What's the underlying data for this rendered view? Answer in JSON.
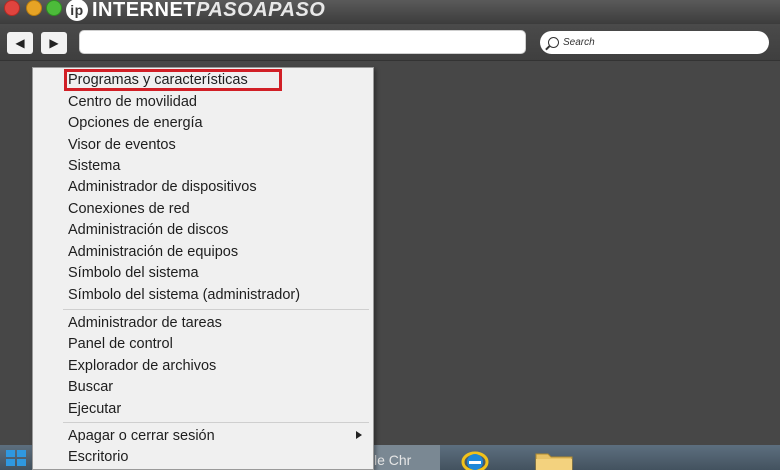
{
  "browser": {
    "logo_text_main": "INTERNET",
    "logo_text_accent": "PASOAPASO",
    "logo_badge": "ip",
    "back_icon": "triangle-left-icon",
    "forward_icon": "triangle-right-icon",
    "search_placeholder": "Search"
  },
  "menu": {
    "items": [
      {
        "label": "Programas y características"
      },
      {
        "label": "Centro de movilidad"
      },
      {
        "label": "Opciones de energía"
      },
      {
        "label": "Visor de eventos"
      },
      {
        "label": "Sistema"
      },
      {
        "label": "Administrador de dispositivos"
      },
      {
        "label": "Conexiones de red"
      },
      {
        "label": "Administración de discos"
      },
      {
        "label": "Administración de equipos"
      },
      {
        "label": "Símbolo del sistema"
      },
      {
        "label": "Símbolo del sistema (administrador)"
      },
      {
        "label": "Administrador de tareas"
      },
      {
        "label": "Panel de control"
      },
      {
        "label": "Explorador de archivos"
      },
      {
        "label": "Buscar"
      },
      {
        "label": "Ejecutar"
      },
      {
        "label": "Apagar o cerrar sesión"
      },
      {
        "label": "Escritorio"
      }
    ],
    "highlight_color": "#d11f26"
  },
  "taskbar": {
    "chrome_label": "le Chr",
    "accent": "#2f98e0"
  }
}
